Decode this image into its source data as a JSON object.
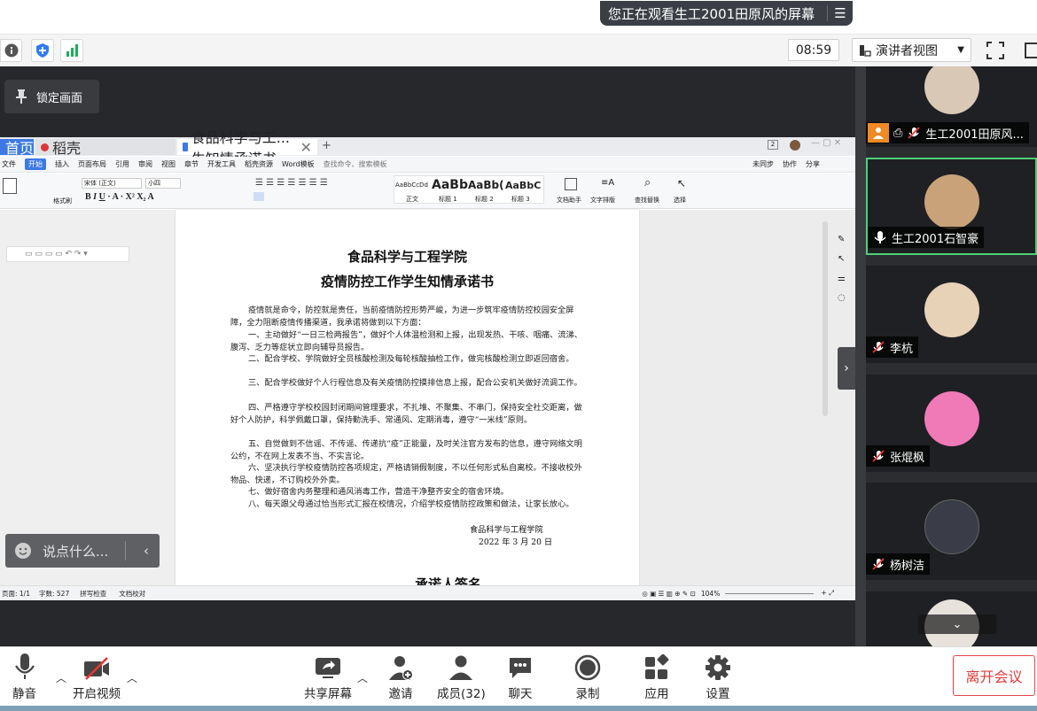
{
  "banner": {
    "text": "您正在观看生工2001田原风的屏幕"
  },
  "infobar": {
    "time": "08:59",
    "view_label": "演讲者视图"
  },
  "share": {
    "lock_label": "锁定画面",
    "chat_placeholder": "说点什么..."
  },
  "wps": {
    "tabs": [
      "首页",
      "稻壳",
      "食品科学与工...生知情承诺书"
    ],
    "menu": [
      "文件",
      "开始",
      "插入",
      "页面布局",
      "引用",
      "审阅",
      "视图",
      "章节",
      "开发工具",
      "稻壳资源",
      "Word模板",
      "查找命令、搜索模板"
    ],
    "menu_right": [
      "未同步",
      "协作",
      "分享"
    ],
    "font_name": "宋体 (正文)",
    "font_size": "小四",
    "styles": [
      {
        "preview": "AaBbCcDd",
        "name": "正文"
      },
      {
        "preview": "AaBb",
        "name": "标题 1"
      },
      {
        "preview": "AaBb(",
        "name": "标题 2"
      },
      {
        "preview": "AaBbC",
        "name": "标题 3"
      }
    ],
    "ribbon_labels": [
      "格式刷",
      "文档助手",
      "文字排版",
      "查找替换",
      "选择"
    ],
    "status": {
      "page": "页面: 1/1",
      "words": "字数: 527",
      "spell": "拼写检查",
      "proof": "文档校对",
      "zoom": "104%"
    }
  },
  "document": {
    "title1": "食品科学与工程学院",
    "title2": "疫情防控工作学生知情承诺书",
    "paragraphs": [
      "疫情就是命令，防控就是责任，当前疫情防控形势严峻，为进一步筑牢疫情防控校园安全屏障，全力阻断疫情传播渠道，我承诺将做到以下方面：",
      "一、主动做好“一日三检两报告”，做好个人体温检测和上报，出现发热、干咳、咽痛、流涕、腹泻、乏力等症状立即向辅导员报告。",
      "二、配合学校、学院做好全员核酸检测及每轮核酸抽检工作，做完核酸检测立即返回宿舍。",
      "三、配合学校做好个人行程信息及有关疫情防控摸排信息上报，配合公安机关做好流调工作。",
      "四、严格遵守学校校园封闭期间管理要求，不扎堆、不聚集、不串门，保持安全社交距离，做好个人防护，科学佩戴口罩，保持勤洗手、常通风、定期消毒，遵守“一米线”原则。",
      "五、自觉做到不信谣、不传谣、传递抗“疫”正能量，及时关注官方发布的信息，遵守网络文明公约，不在网上发表不当、不实言论。",
      "六、坚决执行学校疫情防控各项规定，严格请销假制度，不以任何形式私自离校。不接收校外物品、快递，不订购校外外卖。",
      "七、做好宿舍内务整理和通风消毒工作，营造干净整齐安全的宿舍环境。",
      "八、每天跟父母通过恰当形式汇报在校情况，介绍学校疫情防控政策和做法，让家长放心。"
    ],
    "sign_org": "食品科学与工程学院",
    "sign_date": "2022 年 3 月 20 日",
    "next_heading": "承诺人签名"
  },
  "participants": [
    {
      "name": "生工2001田原风...",
      "color": "#d9c8b6"
    },
    {
      "name": "生工2001石智豪",
      "color": "#c9a27a"
    },
    {
      "name": "李杭",
      "color": "#e7d2b8"
    },
    {
      "name": "张焜枫",
      "color": "#f07ab8"
    },
    {
      "name": "杨树洁",
      "color": "#3a3d48"
    },
    {
      "name": "",
      "color": "#e8e2dc"
    }
  ],
  "toolbar": {
    "mute": "静音",
    "video": "开启视频",
    "share": "共享屏幕",
    "invite": "邀请",
    "members": "成员(32)",
    "chat": "聊天",
    "record": "录制",
    "apps": "应用",
    "settings": "设置",
    "leave": "离开会议"
  },
  "colors": {
    "accent": "#3c79e6",
    "leave": "#e03a3a",
    "active_border": "#4ed17a"
  }
}
